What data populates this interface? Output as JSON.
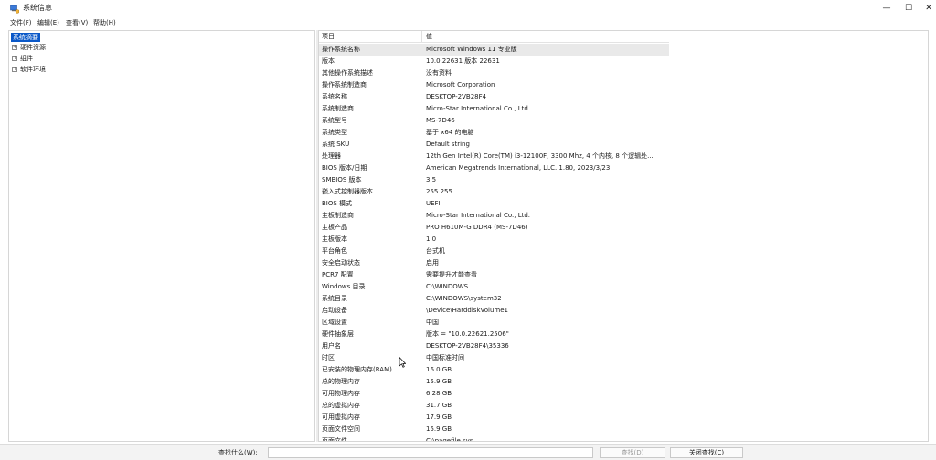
{
  "window": {
    "title": "系统信息",
    "minimize": "—",
    "maximize": "☐",
    "close": "✕"
  },
  "menu": [
    "文件(F)",
    "编辑(E)",
    "查看(V)",
    "帮助(H)"
  ],
  "tree": {
    "root": "系统摘要",
    "children": [
      {
        "label": "硬件资源",
        "expander": "+"
      },
      {
        "label": "组件",
        "expander": "+"
      },
      {
        "label": "软件环境",
        "expander": "+"
      }
    ]
  },
  "details": {
    "header": {
      "item": "项目",
      "value": "值"
    },
    "rows": [
      {
        "k": "操作系统名称",
        "v": "Microsoft Windows 11 专业版"
      },
      {
        "k": "版本",
        "v": "10.0.22631 版本 22631"
      },
      {
        "k": "其他操作系统描述",
        "v": "没有资料"
      },
      {
        "k": "操作系统制造商",
        "v": "Microsoft Corporation"
      },
      {
        "k": "系统名称",
        "v": "DESKTOP-2VB28F4"
      },
      {
        "k": "系统制造商",
        "v": "Micro-Star International Co., Ltd."
      },
      {
        "k": "系统型号",
        "v": "MS-7D46"
      },
      {
        "k": "系统类型",
        "v": "基于 x64 的电脑"
      },
      {
        "k": "系统 SKU",
        "v": "Default string"
      },
      {
        "k": "处理器",
        "v": "12th Gen Intel(R) Core(TM) i3-12100F, 3300 Mhz, 4 个内核, 8 个逻辑处..."
      },
      {
        "k": "BIOS 版本/日期",
        "v": "American Megatrends International, LLC. 1.80, 2023/3/23"
      },
      {
        "k": "SMBIOS 版本",
        "v": "3.5"
      },
      {
        "k": "嵌入式控制器版本",
        "v": "255.255"
      },
      {
        "k": "BIOS 模式",
        "v": "UEFI"
      },
      {
        "k": "主板制造商",
        "v": "Micro-Star International Co., Ltd."
      },
      {
        "k": "主板产品",
        "v": "PRO H610M-G DDR4 (MS-7D46)"
      },
      {
        "k": "主板版本",
        "v": "1.0"
      },
      {
        "k": "平台角色",
        "v": "台式机"
      },
      {
        "k": "安全启动状态",
        "v": "启用"
      },
      {
        "k": "PCR7 配置",
        "v": "需要提升才能查看"
      },
      {
        "k": "Windows 目录",
        "v": "C:\\WINDOWS"
      },
      {
        "k": "系统目录",
        "v": "C:\\WINDOWS\\system32"
      },
      {
        "k": "启动设备",
        "v": "\\Device\\HarddiskVolume1"
      },
      {
        "k": "区域设置",
        "v": "中国"
      },
      {
        "k": "硬件抽象层",
        "v": "版本 = \"10.0.22621.2506\""
      },
      {
        "k": "用户名",
        "v": "DESKTOP-2VB28F4\\35336"
      },
      {
        "k": "时区",
        "v": "中国标准时间"
      },
      {
        "k": "已安装的物理内存(RAM)",
        "v": "16.0 GB"
      },
      {
        "k": "总的物理内存",
        "v": "15.9 GB"
      },
      {
        "k": "可用物理内存",
        "v": "6.28 GB"
      },
      {
        "k": "总的虚拟内存",
        "v": "31.7 GB"
      },
      {
        "k": "可用虚拟内存",
        "v": "17.9 GB"
      },
      {
        "k": "页面文件空间",
        "v": "15.9 GB"
      },
      {
        "k": "页面文件",
        "v": "C:\\pagefile.sys"
      }
    ]
  },
  "find": {
    "label": "查找什么(W):",
    "value": "",
    "find_button": "查找(D)",
    "close_find_button": "关闭查找(C)"
  },
  "colors": {
    "selection": "#0a58c8",
    "row_highlight": "#e9e9e9"
  }
}
